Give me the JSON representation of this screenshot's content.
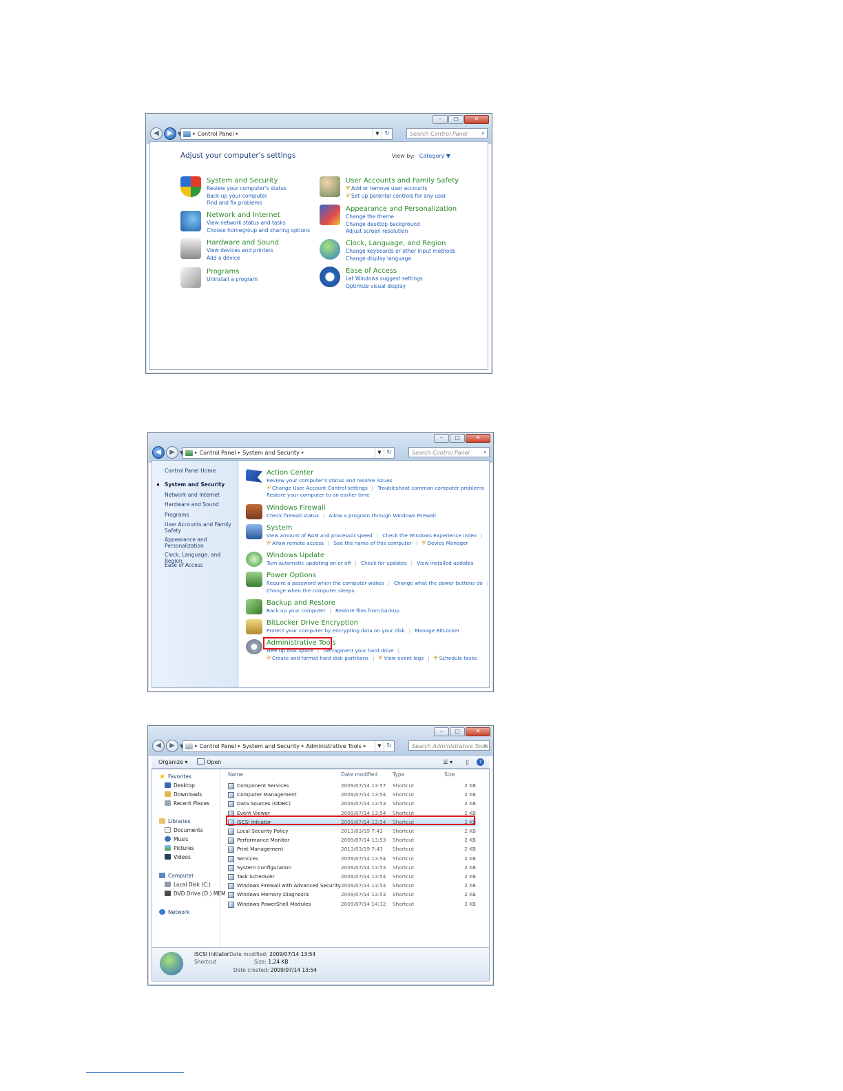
{
  "window1": {
    "address": {
      "root_icon": "control-panel-icon",
      "crumbs": [
        "Control Panel"
      ]
    },
    "search_placeholder": "Search Control Panel",
    "title": "Adjust your computer's settings",
    "view_by_label": "View by:",
    "view_by_value": "Category",
    "left_categories": [
      {
        "icon": "shield-icon",
        "title": "System and Security",
        "links": [
          "Review your computer's status",
          "Back up your computer",
          "Find and fix problems"
        ]
      },
      {
        "icon": "network-icon",
        "title": "Network and Internet",
        "links": [
          "View network status and tasks",
          "Choose homegroup and sharing options"
        ]
      },
      {
        "icon": "printer-icon",
        "title": "Hardware and Sound",
        "links": [
          "View devices and printers",
          "Add a device"
        ]
      },
      {
        "icon": "programs-icon",
        "title": "Programs",
        "links": [
          "Uninstall a program"
        ]
      }
    ],
    "right_categories": [
      {
        "icon": "users-icon",
        "title": "User Accounts and Family Safety",
        "links": [
          "Add or remove user accounts",
          "Set up parental controls for any user"
        ]
      },
      {
        "icon": "appearance-icon",
        "title": "Appearance and Personalization",
        "links": [
          "Change the theme",
          "Change desktop background",
          "Adjust screen resolution"
        ]
      },
      {
        "icon": "globe-clock-icon",
        "title": "Clock, Language, and Region",
        "links": [
          "Change keyboards or other input methods",
          "Change display language"
        ]
      },
      {
        "icon": "ease-of-access-icon",
        "title": "Ease of Access",
        "links": [
          "Let Windows suggest settings",
          "Optimize visual display"
        ]
      }
    ]
  },
  "window2": {
    "address": {
      "crumbs": [
        "Control Panel",
        "System and Security"
      ]
    },
    "search_placeholder": "Search Control Panel",
    "sidebar": {
      "home": "Control Panel Home",
      "current": "System and Security",
      "items": [
        "Network and Internet",
        "Hardware and Sound",
        "Programs",
        "User Accounts and Family Safety",
        "Appearance and Personalization",
        "Clock, Language, and Region",
        "Ease of Access"
      ]
    },
    "sections": [
      {
        "icon": "flag-icon",
        "title": "Action Center",
        "lines": [
          [
            "Review your computer's status and resolve issues"
          ],
          [
            "Change User Account Control settings",
            "Troubleshoot common computer problems"
          ],
          [
            "Restore your computer to an earlier time"
          ]
        ]
      },
      {
        "icon": "firewall-icon",
        "title": "Windows Firewall",
        "lines": [
          [
            "Check firewall status",
            "Allow a program through Windows Firewall"
          ]
        ]
      },
      {
        "icon": "system-icon",
        "title": "System",
        "lines": [
          [
            "View amount of RAM and processor speed",
            "Check the Windows Experience Index"
          ],
          [
            "Allow remote access",
            "See the name of this computer",
            "Device Manager"
          ]
        ]
      },
      {
        "icon": "windows-update-icon",
        "title": "Windows Update",
        "lines": [
          [
            "Turn automatic updating on or off",
            "Check for updates",
            "View installed updates"
          ]
        ]
      },
      {
        "icon": "power-icon",
        "title": "Power Options",
        "lines": [
          [
            "Require a password when the computer wakes",
            "Change what the power buttons do"
          ],
          [
            "Change when the computer sleeps"
          ]
        ]
      },
      {
        "icon": "backup-icon",
        "title": "Backup and Restore",
        "lines": [
          [
            "Back up your computer",
            "Restore files from backup"
          ]
        ]
      },
      {
        "icon": "bitlocker-icon",
        "title": "BitLocker Drive Encryption",
        "lines": [
          [
            "Protect your computer by encrypting data on your disk",
            "Manage BitLocker"
          ]
        ]
      },
      {
        "icon": "admin-tools-icon",
        "title": "Administrative Tools",
        "lines": [
          [
            "Free up disk space",
            "Defragment your hard drive"
          ],
          [
            "Create and format hard disk partitions",
            "View event logs",
            "Schedule tasks"
          ]
        ]
      }
    ]
  },
  "window3": {
    "address": {
      "crumbs": [
        "Control Panel",
        "System and Security",
        "Administrative Tools"
      ]
    },
    "search_placeholder": "Search Administrative Tools",
    "toolbar": {
      "organize": "Organize",
      "open": "Open"
    },
    "nav": {
      "favorites": "Favorites",
      "favorites_items": [
        "Desktop",
        "Downloads",
        "Recent Places"
      ],
      "libraries": "Libraries",
      "libraries_items": [
        "Documents",
        "Music",
        "Pictures",
        "Videos"
      ],
      "computer": "Computer",
      "computer_items": [
        "Local Disk (C:)",
        "DVD Drive (D:) MEM"
      ],
      "network": "Network"
    },
    "columns": {
      "name": "Name",
      "date": "Date modified",
      "type": "Type",
      "size": "Size"
    },
    "rows": [
      {
        "name": "Component Services",
        "date": "2009/07/14 13:57",
        "type": "Shortcut",
        "size": "2 KB"
      },
      {
        "name": "Computer Management",
        "date": "2009/07/14 13:54",
        "type": "Shortcut",
        "size": "2 KB"
      },
      {
        "name": "Data Sources (ODBC)",
        "date": "2009/07/14 13:53",
        "type": "Shortcut",
        "size": "2 KB"
      },
      {
        "name": "Event Viewer",
        "date": "2009/07/14 13:54",
        "type": "Shortcut",
        "size": "2 KB"
      },
      {
        "name": "iSCSI Initiator",
        "date": "2009/07/14 13:54",
        "type": "Shortcut",
        "size": "2 KB"
      },
      {
        "name": "Local Security Policy",
        "date": "2013/03/19 7:43",
        "type": "Shortcut",
        "size": "2 KB"
      },
      {
        "name": "Performance Monitor",
        "date": "2009/07/14 13:53",
        "type": "Shortcut",
        "size": "2 KB"
      },
      {
        "name": "Print Management",
        "date": "2013/03/19 7:43",
        "type": "Shortcut",
        "size": "2 KB"
      },
      {
        "name": "Services",
        "date": "2009/07/14 13:54",
        "type": "Shortcut",
        "size": "2 KB"
      },
      {
        "name": "System Configuration",
        "date": "2009/07/14 13:53",
        "type": "Shortcut",
        "size": "2 KB"
      },
      {
        "name": "Task Scheduler",
        "date": "2009/07/14 13:54",
        "type": "Shortcut",
        "size": "2 KB"
      },
      {
        "name": "Windows Firewall with Advanced Security",
        "date": "2009/07/14 13:54",
        "type": "Shortcut",
        "size": "2 KB"
      },
      {
        "name": "Windows Memory Diagnostic",
        "date": "2009/07/14 13:53",
        "type": "Shortcut",
        "size": "2 KB"
      },
      {
        "name": "Windows PowerShell Modules",
        "date": "2009/07/14 14:32",
        "type": "Shortcut",
        "size": "3 KB"
      }
    ],
    "selected_index": 4,
    "details": {
      "name": "iSCSI Initiator",
      "kind": "Shortcut",
      "modified_label": "Date modified:",
      "modified": "2009/07/14 13:54",
      "size_label": "Size:",
      "size": "1.24 KB",
      "created_label": "Date created:",
      "created": "2009/07/14 13:54"
    }
  }
}
